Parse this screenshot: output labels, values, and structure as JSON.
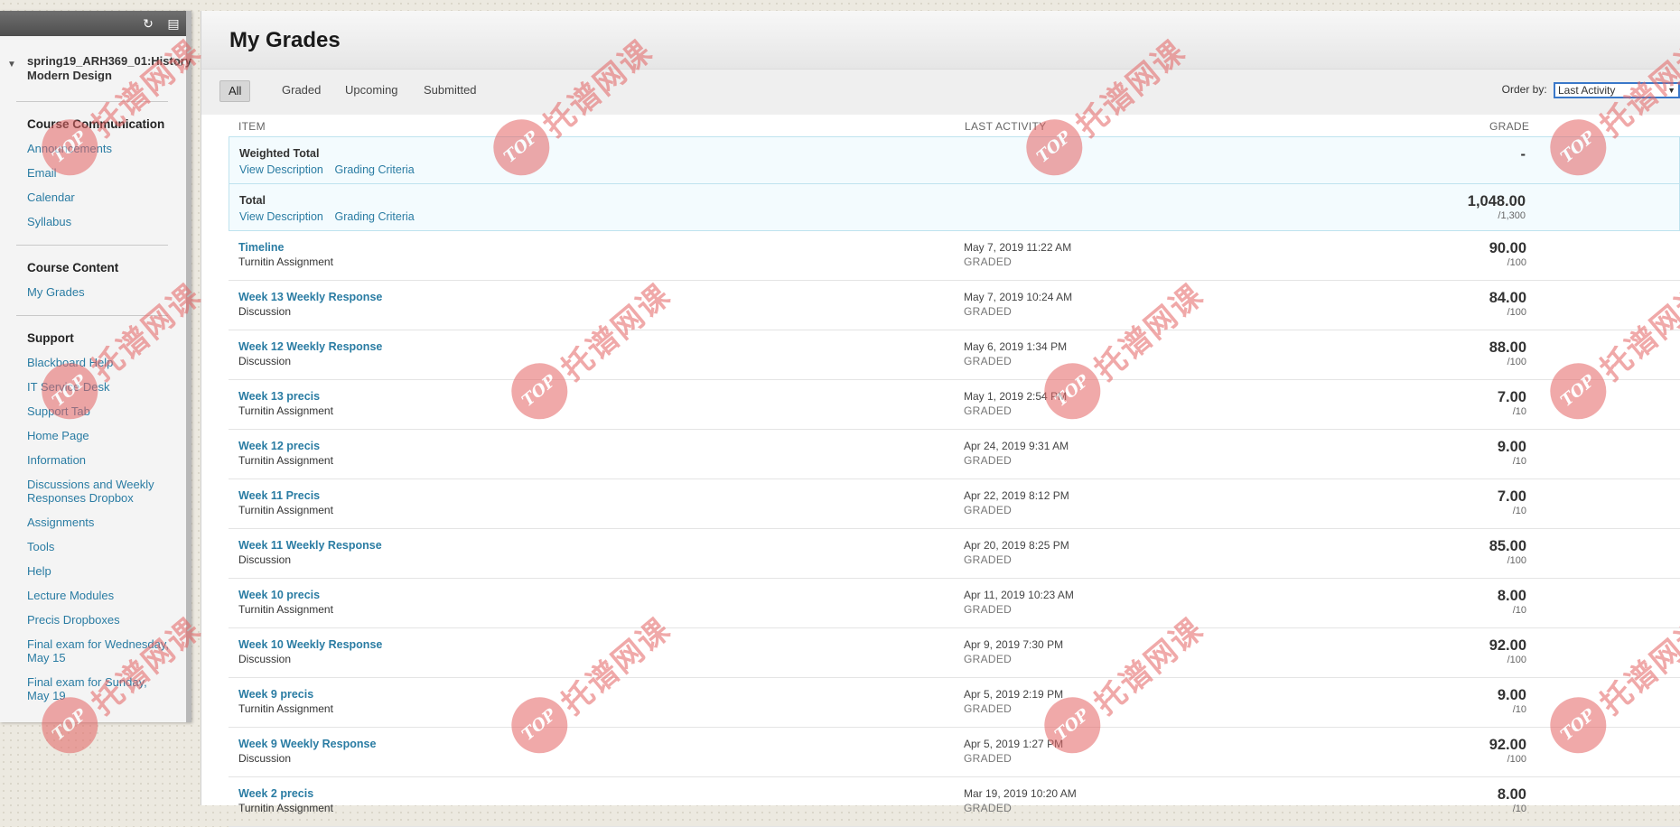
{
  "sidebar": {
    "course_title": "spring19_ARH369_01:History Modern Design",
    "refresh_icon": "refresh-icon",
    "toggle_icon": "panel-toggle-icon",
    "sections": [
      {
        "heading": "Course Communication",
        "links": [
          "Announcements",
          "Email",
          "Calendar",
          "Syllabus"
        ]
      },
      {
        "heading": "Course Content",
        "links": [
          "My Grades"
        ]
      },
      {
        "heading": "Support",
        "links": [
          "Blackboard Help",
          "IT Service Desk",
          "Support Tab",
          "Home Page",
          "Information",
          "Discussions and Weekly Responses Dropbox",
          "Assignments",
          "Tools",
          "Help",
          "Lecture Modules",
          "Precis Dropboxes",
          "Final exam for Wednesday, May 15",
          "Final exam for Sunday, May 19"
        ]
      }
    ]
  },
  "page": {
    "title": "My Grades",
    "tabs": [
      "All",
      "Graded",
      "Upcoming",
      "Submitted"
    ],
    "active_tab": "All",
    "order_by_label": "Order by:",
    "order_by_value": "Last Activity",
    "columns": {
      "item": "ITEM",
      "last_activity": "LAST ACTIVITY",
      "grade": "GRADE"
    }
  },
  "totals": [
    {
      "name": "Weighted Total",
      "links": [
        "View Description",
        "Grading Criteria"
      ],
      "grade": "-",
      "max": ""
    },
    {
      "name": "Total",
      "links": [
        "View Description",
        "Grading Criteria"
      ],
      "grade": "1,048.00",
      "max": "/1,300"
    }
  ],
  "grades": [
    {
      "name": "Timeline",
      "type": "Turnitin Assignment",
      "date": "May 7, 2019 11:22 AM",
      "status": "GRADED",
      "grade": "90.00",
      "max": "/100"
    },
    {
      "name": "Week 13 Weekly Response",
      "type": "Discussion",
      "date": "May 7, 2019 10:24 AM",
      "status": "GRADED",
      "grade": "84.00",
      "max": "/100"
    },
    {
      "name": "Week 12 Weekly Response",
      "type": "Discussion",
      "date": "May 6, 2019 1:34 PM",
      "status": "GRADED",
      "grade": "88.00",
      "max": "/100"
    },
    {
      "name": "Week 13 precis",
      "type": "Turnitin Assignment",
      "date": "May 1, 2019 2:54 PM",
      "status": "GRADED",
      "grade": "7.00",
      "max": "/10"
    },
    {
      "name": "Week 12 precis",
      "type": "Turnitin Assignment",
      "date": "Apr 24, 2019 9:31 AM",
      "status": "GRADED",
      "grade": "9.00",
      "max": "/10"
    },
    {
      "name": "Week 11 Precis",
      "type": "Turnitin Assignment",
      "date": "Apr 22, 2019 8:12 PM",
      "status": "GRADED",
      "grade": "7.00",
      "max": "/10"
    },
    {
      "name": "Week 11 Weekly Response",
      "type": "Discussion",
      "date": "Apr 20, 2019 8:25 PM",
      "status": "GRADED",
      "grade": "85.00",
      "max": "/100"
    },
    {
      "name": "Week 10 precis",
      "type": "Turnitin Assignment",
      "date": "Apr 11, 2019 10:23 AM",
      "status": "GRADED",
      "grade": "8.00",
      "max": "/10"
    },
    {
      "name": "Week 10 Weekly Response",
      "type": "Discussion",
      "date": "Apr 9, 2019 7:30 PM",
      "status": "GRADED",
      "grade": "92.00",
      "max": "/100"
    },
    {
      "name": "Week 9 precis",
      "type": "Turnitin Assignment",
      "date": "Apr 5, 2019 2:19 PM",
      "status": "GRADED",
      "grade": "9.00",
      "max": "/10"
    },
    {
      "name": "Week 9 Weekly Response",
      "type": "Discussion",
      "date": "Apr 5, 2019 1:27 PM",
      "status": "GRADED",
      "grade": "92.00",
      "max": "/100"
    },
    {
      "name": "Week 2 precis",
      "type": "Turnitin Assignment",
      "date": "Mar 19, 2019 10:20 AM",
      "status": "GRADED",
      "grade": "8.00",
      "max": "/10"
    }
  ],
  "watermark": {
    "logo_text": "TOP",
    "text": "托谱网课",
    "color": "#e46464"
  }
}
